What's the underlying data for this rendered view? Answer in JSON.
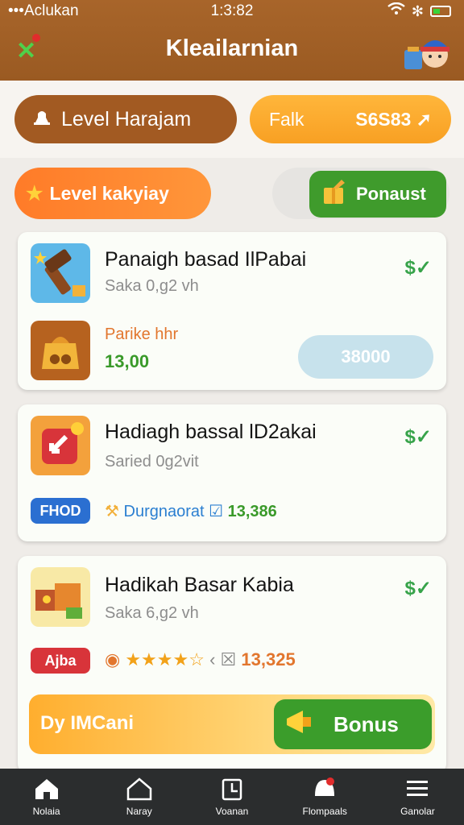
{
  "status": {
    "carrier": "•••Aclukan",
    "time": "1:3:82"
  },
  "header": {
    "title": "Kleailarnian"
  },
  "top_buttons": {
    "level": "Level Harajam",
    "fakk_label": "Falk",
    "fakk_value": "S6S83"
  },
  "secondary_buttons": {
    "kakyiay": "Level kakyiay",
    "ponaust": "Ponaust"
  },
  "cards": [
    {
      "title": "Panaigh basad IlPabai",
      "subtitle": "Saka 0,g2 vh",
      "reward_label": "Parike hhr",
      "reward_value": "13,00",
      "action_value": "38000"
    },
    {
      "title": "Hadiagh bassal lD2akai",
      "subtitle": "Saried 0g2vit",
      "tag": "FHOD",
      "info_text": "Durgnaorat",
      "count": "13,386"
    },
    {
      "title": "Hadikah Basar Kabia",
      "subtitle": "Saka 6,g2 vh",
      "tag": "Ajba",
      "stars": 4.5,
      "count": "13,325"
    }
  ],
  "bonus": {
    "label": "Dy IMCani",
    "button": "Bonus"
  },
  "nav": [
    {
      "label": "Nolaia"
    },
    {
      "label": "Naray"
    },
    {
      "label": "Voanan"
    },
    {
      "label": "Flompaals"
    },
    {
      "label": "Ganolar"
    }
  ],
  "colors": {
    "header": "#9a5a22",
    "orange": "#f8a023",
    "green": "#3f9b2c",
    "nav_bg": "#2b2d2e"
  }
}
